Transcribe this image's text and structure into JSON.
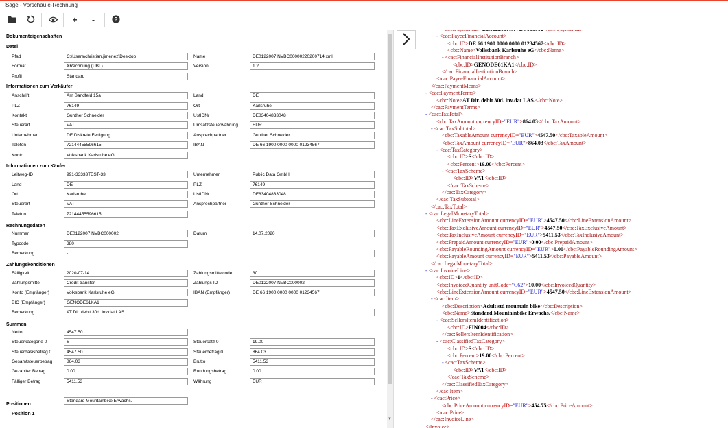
{
  "window": {
    "title": "Sage - Vorschau e-Rechnung"
  },
  "toolbar": {
    "add_label": "+",
    "remove_label": "-"
  },
  "icons": [
    "folder-open-icon",
    "refresh-icon",
    "eye-icon",
    "help-icon",
    "chevron-right-icon"
  ],
  "sections": {
    "doc": "Dokumenteigenschaften",
    "file": "Datei",
    "seller": "Informationen zum Verkäufer",
    "buyer": "Informationen zum Käufer",
    "invoice": "Rechnungsdaten",
    "payment": "Zahlungskonditionen",
    "totals": "Summen",
    "positions": "Positionen",
    "position1": "Position 1"
  },
  "fields": [
    {
      "label": "Pfad",
      "value": "C:\\Users\\christian.jimenez\\Desktop",
      "col": 0,
      "row": 0
    },
    {
      "label": "Name",
      "value": "DE0122007INVBC00000220200714.xml",
      "col": 1,
      "row": 0
    },
    {
      "label": "Format",
      "value": "XRechnung (UBL)",
      "col": 0,
      "row": 1
    },
    {
      "label": "Version",
      "value": "1.2",
      "col": 1,
      "row": 1
    },
    {
      "label": "Profil",
      "value": "Standard",
      "col": 0,
      "row": 2
    },
    {
      "label": "Anschrift",
      "value": "Am Sandfeld 15a",
      "col": 0,
      "row": 4
    },
    {
      "label": "Land",
      "value": "DE",
      "col": 1,
      "row": 4
    },
    {
      "label": "PLZ",
      "value": "76149",
      "col": 0,
      "row": 5
    },
    {
      "label": "Ort",
      "value": "Karlsruhe",
      "col": 1,
      "row": 5
    },
    {
      "label": "Kontakt",
      "value": "Gunther Schneider",
      "col": 0,
      "row": 6
    },
    {
      "label": "UstIDNr",
      "value": "DE83404833048",
      "col": 1,
      "row": 6
    },
    {
      "label": "Steuerart",
      "value": "VAT",
      "col": 0,
      "row": 7
    },
    {
      "label": "Umsatzsteuerwährung",
      "value": "EUR",
      "col": 1,
      "row": 7
    },
    {
      "label": "Unternehmen",
      "value": "DE Diskrete Fertigung",
      "col": 0,
      "row": 8
    },
    {
      "label": "Ansprechpartner",
      "value": "Gunther Schneider",
      "col": 1,
      "row": 8
    },
    {
      "label": "Telefon",
      "value": "72144455596615",
      "col": 0,
      "row": 9
    },
    {
      "label": "IBAN",
      "value": "DE 66 1900 0000 0000 01234567",
      "col": 1,
      "row": 9
    },
    {
      "label": "Konto",
      "value": "Volksbank Karlsruhe eG",
      "col": 0,
      "row": 10
    },
    {
      "label": "Leitweg-ID",
      "value": "991-33333TEST-33",
      "col": 0,
      "row": 12
    },
    {
      "label": "Unternehmen",
      "value": "Public Data GmbH",
      "col": 1,
      "row": 12
    },
    {
      "label": "Land",
      "value": "DE",
      "col": 0,
      "row": 13
    },
    {
      "label": "PLZ",
      "value": "76149",
      "col": 1,
      "row": 13
    },
    {
      "label": "Ort",
      "value": "Karlsruhe",
      "col": 0,
      "row": 14
    },
    {
      "label": "UstIDNr",
      "value": "DE83404833048",
      "col": 1,
      "row": 14
    },
    {
      "label": "Steuerart",
      "value": "VAT",
      "col": 0,
      "row": 15
    },
    {
      "label": "Ansprechpartner",
      "value": "Gunther Schneider",
      "col": 1,
      "row": 15
    },
    {
      "label": "Telefon",
      "value": "72144455596615",
      "col": 0,
      "row": 16
    },
    {
      "label": "Nummer",
      "value": "DE0122007INVBC000002",
      "col": 0,
      "row": 18
    },
    {
      "label": "Datum",
      "value": "14.07.2020",
      "col": 1,
      "row": 18
    },
    {
      "label": "Typcode",
      "value": "380",
      "col": 0,
      "row": 19
    },
    {
      "label": "Bemerkung",
      "value": "-",
      "col": 0,
      "row": 20,
      "wide": true
    },
    {
      "label": "Fälligkeit",
      "value": "2020-07-14",
      "col": 0,
      "row": 22
    },
    {
      "label": "Zahlungsmittelcode",
      "value": "30",
      "col": 1,
      "row": 22
    },
    {
      "label": "Zahlungsmittel",
      "value": "Credit transfer",
      "col": 0,
      "row": 23
    },
    {
      "label": "Zahlungs-ID",
      "value": "DE0122007INVBC000002",
      "col": 1,
      "row": 23
    },
    {
      "label": "Konto (Empfänger)",
      "value": "Volksbank Karlsruhe eG",
      "col": 0,
      "row": 24
    },
    {
      "label": "IBAN (Empfänger)",
      "value": "DE 66 1900 0000 0000 01234567",
      "col": 1,
      "row": 24
    },
    {
      "label": "BIC (Empfänger)",
      "value": "GENODE61KA1",
      "col": 0,
      "row": 25
    },
    {
      "label": "Bemerkung",
      "value": "AT Dir. debit 30d. inv.dat LAS.",
      "col": 0,
      "row": 26,
      "wide": true
    },
    {
      "label": "Netto",
      "value": "4547.50",
      "col": 0,
      "row": 28
    },
    {
      "label": "Steuerkategorie 0",
      "value": "S",
      "col": 0,
      "row": 29
    },
    {
      "label": "Steuersatz 0",
      "value": "19.00",
      "col": 1,
      "row": 29
    },
    {
      "label": "Steuerbasisbetrag 0",
      "value": "4547.50",
      "col": 0,
      "row": 30
    },
    {
      "label": "Steuerbetrag 0",
      "value": "864.03",
      "col": 1,
      "row": 30
    },
    {
      "label": "Gesamtsteuerbetrag",
      "value": "864.03",
      "col": 0,
      "row": 31
    },
    {
      "label": "Brutto",
      "value": "5411.53",
      "col": 1,
      "row": 31
    },
    {
      "label": "Gezahlter Betrag",
      "value": "0.00",
      "col": 0,
      "row": 32
    },
    {
      "label": "Rundungsbetrag",
      "value": "0.00",
      "col": 1,
      "row": 32
    },
    {
      "label": "Fälliger Betrag",
      "value": "5411.53",
      "col": 0,
      "row": 33
    },
    {
      "label": "Währung",
      "value": "EUR",
      "col": 1,
      "row": 33
    },
    {
      "label": "",
      "value": "Standard Mountainbike Erwachs.",
      "col": 0,
      "row": 35
    }
  ],
  "xml_lines": [
    {
      "i": 3,
      "m": "",
      "t": "</cbc:PaymentID>",
      "v": "DE0122007INVBC000002",
      "close": "</cbc:PaymentID>",
      "pre": "<cbc:PaymentID>"
    },
    {
      "i": 2,
      "m": "-",
      "t": "<cac:PayeeFinancialAccount>"
    },
    {
      "i": 4,
      "pre": "<cbc:ID>",
      "v": "DE 66 1900 0000 0000 01234567",
      "close": "</cbc:ID>"
    },
    {
      "i": 4,
      "pre": "<cbc:Name>",
      "v": "Volksbank Karlsruhe eG",
      "close": "</cbc:Name>"
    },
    {
      "i": 3,
      "m": "-",
      "t": "<cac:FinancialInstitutionBranch>"
    },
    {
      "i": 5,
      "pre": "<cbc:ID>",
      "v": "GENODE61KA1",
      "close": "</cbc:ID>"
    },
    {
      "i": 3,
      "t": "</cac:FinancialInstitutionBranch>"
    },
    {
      "i": 2,
      "t": "</cac:PayeeFinancialAccount>"
    },
    {
      "i": 1,
      "t": "</cac:PaymentMeans>"
    },
    {
      "i": 0,
      "m": "-",
      "t": "<cac:PaymentTerms>"
    },
    {
      "i": 2,
      "pre": "<cbc:Note>",
      "v": "AT Dir. debit 30d. inv.dat LAS.",
      "close": "</cbc:Note>"
    },
    {
      "i": 1,
      "t": "</cac:PaymentTerms>"
    },
    {
      "i": 0,
      "m": "-",
      "t": "<cac:TaxTotal>"
    },
    {
      "i": 2,
      "pre": "<cbc:TaxAmount",
      "attr": " currencyID=",
      "q": "\"EUR\"",
      "pre2": ">",
      "v": "864.03",
      "close": "</cbc:TaxAmount>"
    },
    {
      "i": 1,
      "m": "-",
      "t": "<cac:TaxSubtotal>"
    },
    {
      "i": 3,
      "pre": "<cbc:TaxableAmount",
      "attr": " currencyID=",
      "q": "\"EUR\"",
      "pre2": ">",
      "v": "4547.50",
      "close": "</cbc:TaxableAmount>"
    },
    {
      "i": 3,
      "pre": "<cbc:TaxAmount",
      "attr": " currencyID=",
      "q": "\"EUR\"",
      "pre2": ">",
      "v": "864.03",
      "close": "</cbc:TaxAmount>"
    },
    {
      "i": 2,
      "m": "-",
      "t": "<cac:TaxCategory>"
    },
    {
      "i": 4,
      "pre": "<cbc:ID>",
      "v": "S",
      "close": "</cbc:ID>"
    },
    {
      "i": 4,
      "pre": "<cbc:Percent>",
      "v": "19.00",
      "close": "</cbc:Percent>"
    },
    {
      "i": 3,
      "m": "-",
      "t": "<cac:TaxScheme>"
    },
    {
      "i": 5,
      "pre": "<cbc:ID>",
      "v": "VAT",
      "close": "</cbc:ID>"
    },
    {
      "i": 4,
      "t": "</cac:TaxScheme>"
    },
    {
      "i": 3,
      "t": "</cac:TaxCategory>"
    },
    {
      "i": 2,
      "t": "</cac:TaxSubtotal>"
    },
    {
      "i": 1,
      "t": "</cac:TaxTotal>"
    },
    {
      "i": 0,
      "m": "-",
      "t": "<cac:LegalMonetaryTotal>"
    },
    {
      "i": 2,
      "pre": "<cbc:LineExtensionAmount",
      "attr": " currencyID=",
      "q": "\"EUR\"",
      "pre2": ">",
      "v": "4547.50",
      "close": "</cbc:LineExtensionAmount>"
    },
    {
      "i": 2,
      "pre": "<cbc:TaxExclusiveAmount",
      "attr": " currencyID=",
      "q": "\"EUR\"",
      "pre2": ">",
      "v": "4547.50",
      "close": "</cbc:TaxExclusiveAmount>"
    },
    {
      "i": 2,
      "pre": "<cbc:TaxInclusiveAmount",
      "attr": " currencyID=",
      "q": "\"EUR\"",
      "pre2": ">",
      "v": "5411.53",
      "close": "</cbc:TaxInclusiveAmount>"
    },
    {
      "i": 2,
      "pre": "<cbc:PrepaidAmount",
      "attr": " currencyID=",
      "q": "\"EUR\"",
      "pre2": ">",
      "v": "0.00",
      "close": "</cbc:PrepaidAmount>"
    },
    {
      "i": 2,
      "pre": "<cbc:PayableRoundingAmount",
      "attr": " currencyID=",
      "q": "\"EUR\"",
      "pre2": ">",
      "v": "0.00",
      "close": "</cbc:PayableRoundingAmount>"
    },
    {
      "i": 2,
      "pre": "<cbc:PayableAmount",
      "attr": " currencyID=",
      "q": "\"EUR\"",
      "pre2": ">",
      "v": "5411.53",
      "close": "</cbc:PayableAmount>"
    },
    {
      "i": 1,
      "t": "</cac:LegalMonetaryTotal>"
    },
    {
      "i": 0,
      "m": "-",
      "t": "<cac:InvoiceLine>"
    },
    {
      "i": 2,
      "pre": "<cbc:ID>",
      "v": "1",
      "close": "</cbc:ID>"
    },
    {
      "i": 2,
      "pre": "<cbc:InvoicedQuantity",
      "attr": " unitCode=",
      "q": "\"C62\"",
      "pre2": ">",
      "v": "10.00",
      "close": "</cbc:InvoicedQuantity>"
    },
    {
      "i": 2,
      "pre": "<cbc:LineExtensionAmount",
      "attr": " currencyID=",
      "q": "\"EUR\"",
      "pre2": ">",
      "v": "4547.50",
      "close": "</cbc:LineExtensionAmount>"
    },
    {
      "i": 1,
      "m": "-",
      "t": "<cac:Item>"
    },
    {
      "i": 3,
      "pre": "<cbc:Description>",
      "v": "Adult std mountain bike",
      "close": "</cbc:Description>"
    },
    {
      "i": 3,
      "pre": "<cbc:Name>",
      "v": "Standard Mountainbike Erwachs.",
      "close": "</cbc:Name>"
    },
    {
      "i": 2,
      "m": "-",
      "t": "<cac:SellersItemIdentification>"
    },
    {
      "i": 4,
      "pre": "<cbc:ID>",
      "v": "FIN004",
      "close": "</cbc:ID>"
    },
    {
      "i": 3,
      "t": "</cac:SellersItemIdentification>"
    },
    {
      "i": 2,
      "m": "-",
      "t": "<cac:ClassifiedTaxCategory>"
    },
    {
      "i": 4,
      "pre": "<cbc:ID>",
      "v": "S",
      "close": "</cbc:ID>"
    },
    {
      "i": 4,
      "pre": "<cbc:Percent>",
      "v": "19.00",
      "close": "</cbc:Percent>"
    },
    {
      "i": 3,
      "m": "-",
      "t": "<cac:TaxScheme>"
    },
    {
      "i": 5,
      "pre": "<cbc:ID>",
      "v": "VAT",
      "close": "</cbc:ID>"
    },
    {
      "i": 4,
      "t": "</cac:TaxScheme>"
    },
    {
      "i": 3,
      "t": "</cac:ClassifiedTaxCategory>"
    },
    {
      "i": 2,
      "t": "</cac:Item>"
    },
    {
      "i": 1,
      "m": "-",
      "t": "<cac:Price>"
    },
    {
      "i": 3,
      "pre": "<cbc:PriceAmount",
      "attr": " currencyID=",
      "q": "\"EUR\"",
      "pre2": ">",
      "v": "454.75",
      "close": "</cbc:PriceAmount>"
    },
    {
      "i": 2,
      "t": "</cac:Price>"
    },
    {
      "i": 1,
      "t": "</cac:InvoiceLine>"
    },
    {
      "i": 0,
      "t": "</Invoice>"
    }
  ]
}
